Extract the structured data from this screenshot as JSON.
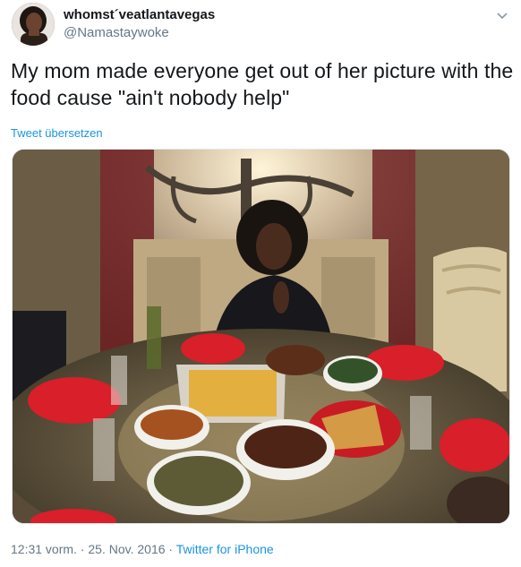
{
  "user": {
    "display_name": "whomst´veatlantavegas",
    "handle": "@Namastaywoke"
  },
  "tweet": {
    "text": "My mom made everyone get out of her picture with the food cause \"ain't nobody help\"",
    "translate_label": "Tweet übersetzen"
  },
  "meta": {
    "time": "12:31 vorm.",
    "separator1": " · ",
    "date": "25. Nov. 2016",
    "separator2": " · ",
    "source": "Twitter for iPhone"
  },
  "colors": {
    "link": "#1b95e0",
    "secondary_text": "#657786",
    "plate_red": "#d81f2a"
  },
  "icons": {
    "caret": "chevron-down-icon"
  }
}
